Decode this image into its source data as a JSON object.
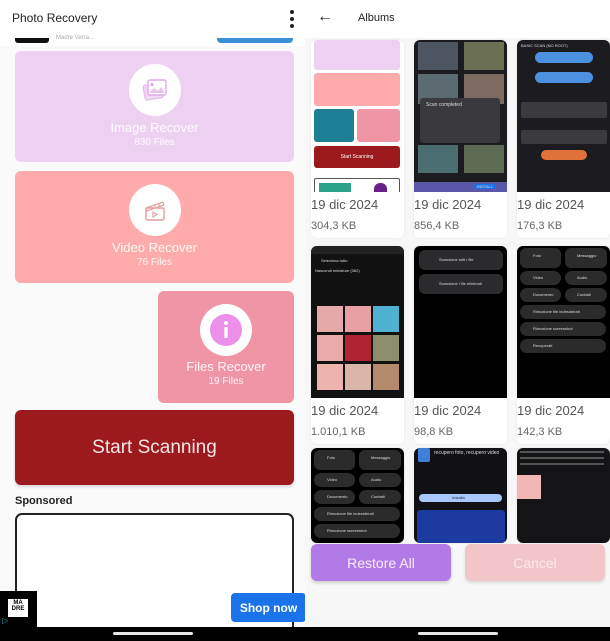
{
  "left_screen": {
    "app_title": "Photo Recovery",
    "menu_icon": "more-vert-icon",
    "top_ad_text": "Madre Verra...",
    "categories": [
      {
        "label": "Image Recover",
        "count": "830  Files",
        "icon": "image-icon",
        "color": "#edd0f2"
      },
      {
        "label": "Video Recover",
        "count": "76  Files",
        "icon": "clapperboard-icon",
        "color": "#ffabab"
      },
      {
        "label": "Files Recover",
        "count": "19  Files",
        "icon": "info-icon",
        "color": "#f095a6"
      }
    ],
    "scan_button": "Start Scanning",
    "scan_button_color": "#9c1a1e",
    "sponsored_label": "Sponsored",
    "ad_logo_text": "MA DRE",
    "shop_button": "Shop now",
    "shop_button_color": "#1a73e8"
  },
  "right_screen": {
    "back_icon": "arrow-left-icon",
    "title": "Albums",
    "albums": [
      {
        "date": "19 dic 2024",
        "size": "304,3 KB",
        "thumb": "app-home-screenshot",
        "thumb_text": "Start Scanning"
      },
      {
        "date": "19 dic 2024",
        "size": "856,4 KB",
        "thumb": "scan-completed-dialog",
        "thumb_text": "Scan completed",
        "thumb_btn": "INSTALL"
      },
      {
        "date": "19 dic 2024",
        "size": "176,3 KB",
        "thumb": "scan-options-screen",
        "thumb_text": "BASIC SCAN (NO ROOT)"
      },
      {
        "date": "19 dic 2024",
        "size": "1.010,1 KB",
        "thumb": "photo-gallery-grid",
        "thumb_text": "Seleziona tutto",
        "thumb_sub": "Nascondi miniature (362)"
      },
      {
        "date": "19 dic 2024",
        "size": "98,8 KB",
        "thumb": "scan-menu",
        "thumb_items": [
          "Scansione tutti i file",
          "Scansione i file eliminati"
        ]
      },
      {
        "date": "19 dic 2024",
        "size": "142,3 KB",
        "thumb": "recovery-menu",
        "thumb_items": [
          "Foto",
          "Messaggio",
          "Video",
          "Audio",
          "Documento",
          "Contatti",
          "Rimozione file indesiderati",
          "Rimozione screenshot",
          "Recuperati"
        ]
      },
      {
        "thumb": "recovery-menu",
        "thumb_items": [
          "Foto",
          "Messaggio",
          "Video",
          "Audio",
          "Documento",
          "Contatti",
          "Rimozione file indesiderati",
          "Rimozione screenshot"
        ]
      },
      {
        "thumb": "play-store-listing",
        "thumb_text": "recupero foto, recupero video",
        "thumb_btn": "Installa"
      },
      {
        "thumb": "article-page"
      }
    ],
    "restore_button": "Restore All",
    "restore_button_color": "#b17ae6",
    "cancel_button": "Cancel",
    "cancel_button_color": "#f2c6c8"
  }
}
